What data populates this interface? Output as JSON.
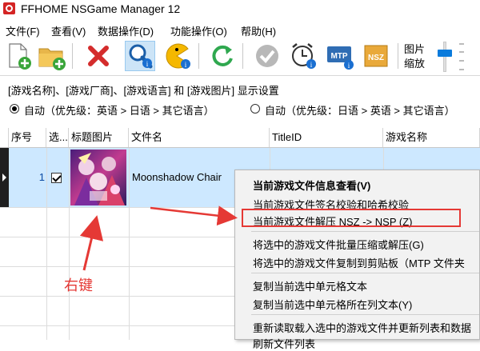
{
  "window": {
    "title": "FFHOME NSGame Manager 12"
  },
  "menu": [
    "文件(F)",
    "查看(V)",
    "数据操作(D)",
    "功能操作(O)",
    "帮助(H)"
  ],
  "toolbar": {
    "buttons": [
      "add-file",
      "add-folder",
      "remove",
      "search-info",
      "pacman",
      "refresh",
      "verify",
      "clock-info",
      "mtp-info",
      "nsz-compress"
    ],
    "zoom_label_line1": "图片",
    "zoom_label_line2": "缩放"
  },
  "settings": {
    "title": "[游戏名称]、[游戏厂商]、[游戏语言] 和 [游戏图片] 显示设置",
    "radio1": "自动（优先级：英语 > 日语 > 其它语言）",
    "radio2": "自动（优先级：日语 > 英语 > 其它语言）"
  },
  "grid": {
    "columns": [
      "序号",
      "选...",
      "标题图片",
      "文件名",
      "TitleID",
      "游戏名称"
    ],
    "rows": [
      {
        "seq": "1",
        "checked": true,
        "filename": "Moonshadow Chair"
      }
    ]
  },
  "context_menu": {
    "items": [
      "当前游戏文件信息查看(V)",
      "当前游戏文件签名校验和哈希校验",
      "当前游戏文件解压 NSZ -> NSP (Z)",
      "将选中的游戏文件批量压缩或解压(G)",
      "将选中的游戏文件复制到剪贴板（MTP 文件夹",
      "复制当前选中单元格文本",
      "复制当前选中单元格所在列文本(Y)",
      "重新读取载入选中的游戏文件并更新列表和数据",
      "刷新文件列表"
    ],
    "highlighted_index": 2
  },
  "annotation": {
    "label": "右键",
    "color": "#e53935"
  },
  "colors": {
    "selection": "#cde8ff",
    "accent": "#0a7bdc",
    "annotation_red": "#e53935"
  }
}
